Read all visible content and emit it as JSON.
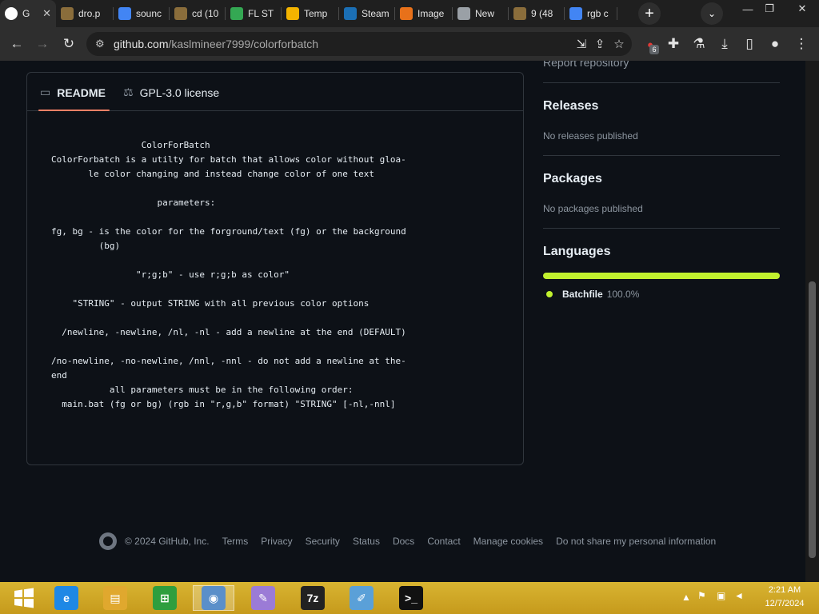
{
  "browser": {
    "tabs": [
      {
        "label": "G",
        "icon": "github-icon",
        "icon_color": "#ffffff",
        "active": true
      },
      {
        "label": "dro.p",
        "icon": "folder-icon",
        "icon_color": "#8a6d3b"
      },
      {
        "label": "sounc",
        "icon": "google-icon",
        "icon_color": "#4285f4"
      },
      {
        "label": "cd (10",
        "icon": "folder-icon",
        "icon_color": "#8a6d3b"
      },
      {
        "label": "FL ST",
        "icon": "play-icon",
        "icon_color": "#34a853"
      },
      {
        "label": "Temp",
        "icon": "mail-icon",
        "icon_color": "#f4b400"
      },
      {
        "label": "Steam",
        "icon": "steam-icon",
        "icon_color": "#1b6fb5"
      },
      {
        "label": "Image",
        "icon": "flame-icon",
        "icon_color": "#e8711a"
      },
      {
        "label": "New",
        "icon": "chrome-icon",
        "icon_color": "#9aa0a6"
      },
      {
        "label": "9 (48",
        "icon": "folder-icon",
        "icon_color": "#8a6d3b"
      },
      {
        "label": "rgb c",
        "icon": "google-icon",
        "icon_color": "#4285f4"
      }
    ],
    "url_host": "github.com",
    "url_path": "/kaslmineer7999/colorforbatch",
    "extension_badge": "6"
  },
  "readme": {
    "tab_readme": "README",
    "tab_license": "GPL-3.0 license",
    "content": "                 ColorForBatch\nColorForbatch is a utilty for batch that allows color without gloa-\n       le color changing and instead change color of one text\n\n                    parameters:\n\nfg, bg - is the color for the forground/text (fg) or the background\n         (bg)\n\n                \"r;g;b\" - use r;g;b as color\"\n\n    \"STRING\" - output STRING with all previous color options\n\n  /newline, -newline, /nl, -nl - add a newline at the end (DEFAULT)\n\n/no-newline, -no-newline, /nnl, -nnl - do not add a newline at the-\nend\n           all parameters must be in the following order:\n  main.bat (fg or bg) (rgb in \"r,g,b\" format) \"STRING\" [-nl,-nnl]"
  },
  "sidebar": {
    "report": "Report repository",
    "releases_title": "Releases",
    "releases_text": "No releases published",
    "packages_title": "Packages",
    "packages_text": "No packages published",
    "languages_title": "Languages",
    "language_name": "Batchfile",
    "language_pct": "100.0%",
    "language_color": "#c1f12e"
  },
  "footer": {
    "copyright": "© 2024 GitHub, Inc.",
    "links": [
      "Terms",
      "Privacy",
      "Security",
      "Status",
      "Docs",
      "Contact",
      "Manage cookies",
      "Do not share my personal information"
    ]
  },
  "taskbar": {
    "time": "2:21 AM",
    "date": "12/7/2024",
    "apps": [
      {
        "name": "ie-icon",
        "glyph": "e",
        "color": "#1e88e5"
      },
      {
        "name": "file-explorer-icon",
        "glyph": "▤",
        "color": "#e0a82e"
      },
      {
        "name": "store-icon",
        "glyph": "⊞",
        "color": "#2e9e3e"
      },
      {
        "name": "chrome-icon",
        "glyph": "◉",
        "color": "#5a8fc9"
      },
      {
        "name": "paint-icon",
        "glyph": "✎",
        "color": "#9b7bd6"
      },
      {
        "name": "7zip-icon",
        "glyph": "7z",
        "color": "#222222"
      },
      {
        "name": "notepad-icon",
        "glyph": "✐",
        "color": "#5aa0d8"
      },
      {
        "name": "cmd-icon",
        "glyph": ">_",
        "color": "#111111"
      }
    ]
  }
}
